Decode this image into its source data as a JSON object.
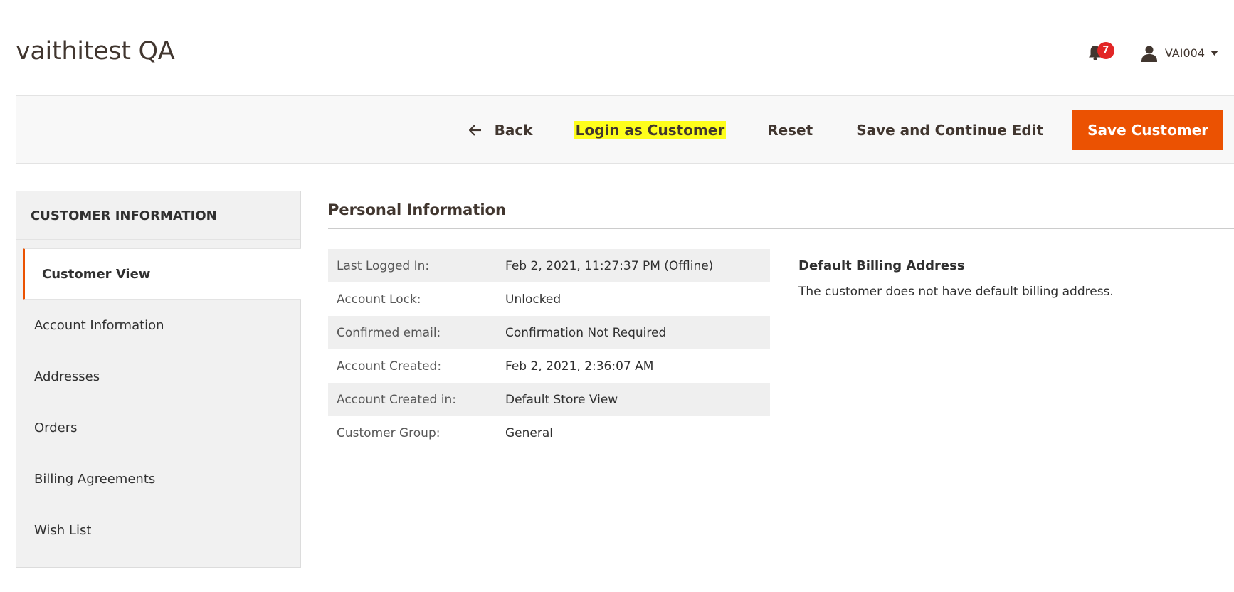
{
  "page": {
    "title": "vaithitest QA"
  },
  "header": {
    "notifications": {
      "icon": "bell-icon",
      "count": "7",
      "badge_color": "#e22626"
    },
    "user": {
      "icon": "user-icon",
      "name": "VAI004",
      "caret_icon": "caret-down-icon"
    }
  },
  "toolbar": {
    "back_label": "Back",
    "back_icon": "arrow-left-icon",
    "login_as_customer_label": "Login as Customer",
    "login_highlight_color": "#fefe1c",
    "reset_label": "Reset",
    "save_continue_label": "Save and Continue Edit",
    "save_customer_label": "Save Customer",
    "primary_color": "#eb5202"
  },
  "sidebar": {
    "title": "CUSTOMER INFORMATION",
    "items": [
      {
        "label": "Customer View",
        "active": true
      },
      {
        "label": "Account Information",
        "active": false
      },
      {
        "label": "Addresses",
        "active": false
      },
      {
        "label": "Orders",
        "active": false
      },
      {
        "label": "Billing Agreements",
        "active": false
      },
      {
        "label": "Wish List",
        "active": false
      }
    ]
  },
  "personal_info": {
    "title": "Personal Information",
    "rows": [
      {
        "label": "Last Logged In:",
        "value": "Feb 2, 2021, 11:27:37 PM (Offline)"
      },
      {
        "label": "Account Lock:",
        "value": "Unlocked"
      },
      {
        "label": "Confirmed email:",
        "value": "Confirmation Not Required"
      },
      {
        "label": "Account Created:",
        "value": "Feb 2, 2021, 2:36:07 AM"
      },
      {
        "label": "Account Created in:",
        "value": "Default Store View"
      },
      {
        "label": "Customer Group:",
        "value": "General"
      }
    ]
  },
  "billing": {
    "title": "Default Billing Address",
    "text": "The customer does not have default billing address."
  }
}
